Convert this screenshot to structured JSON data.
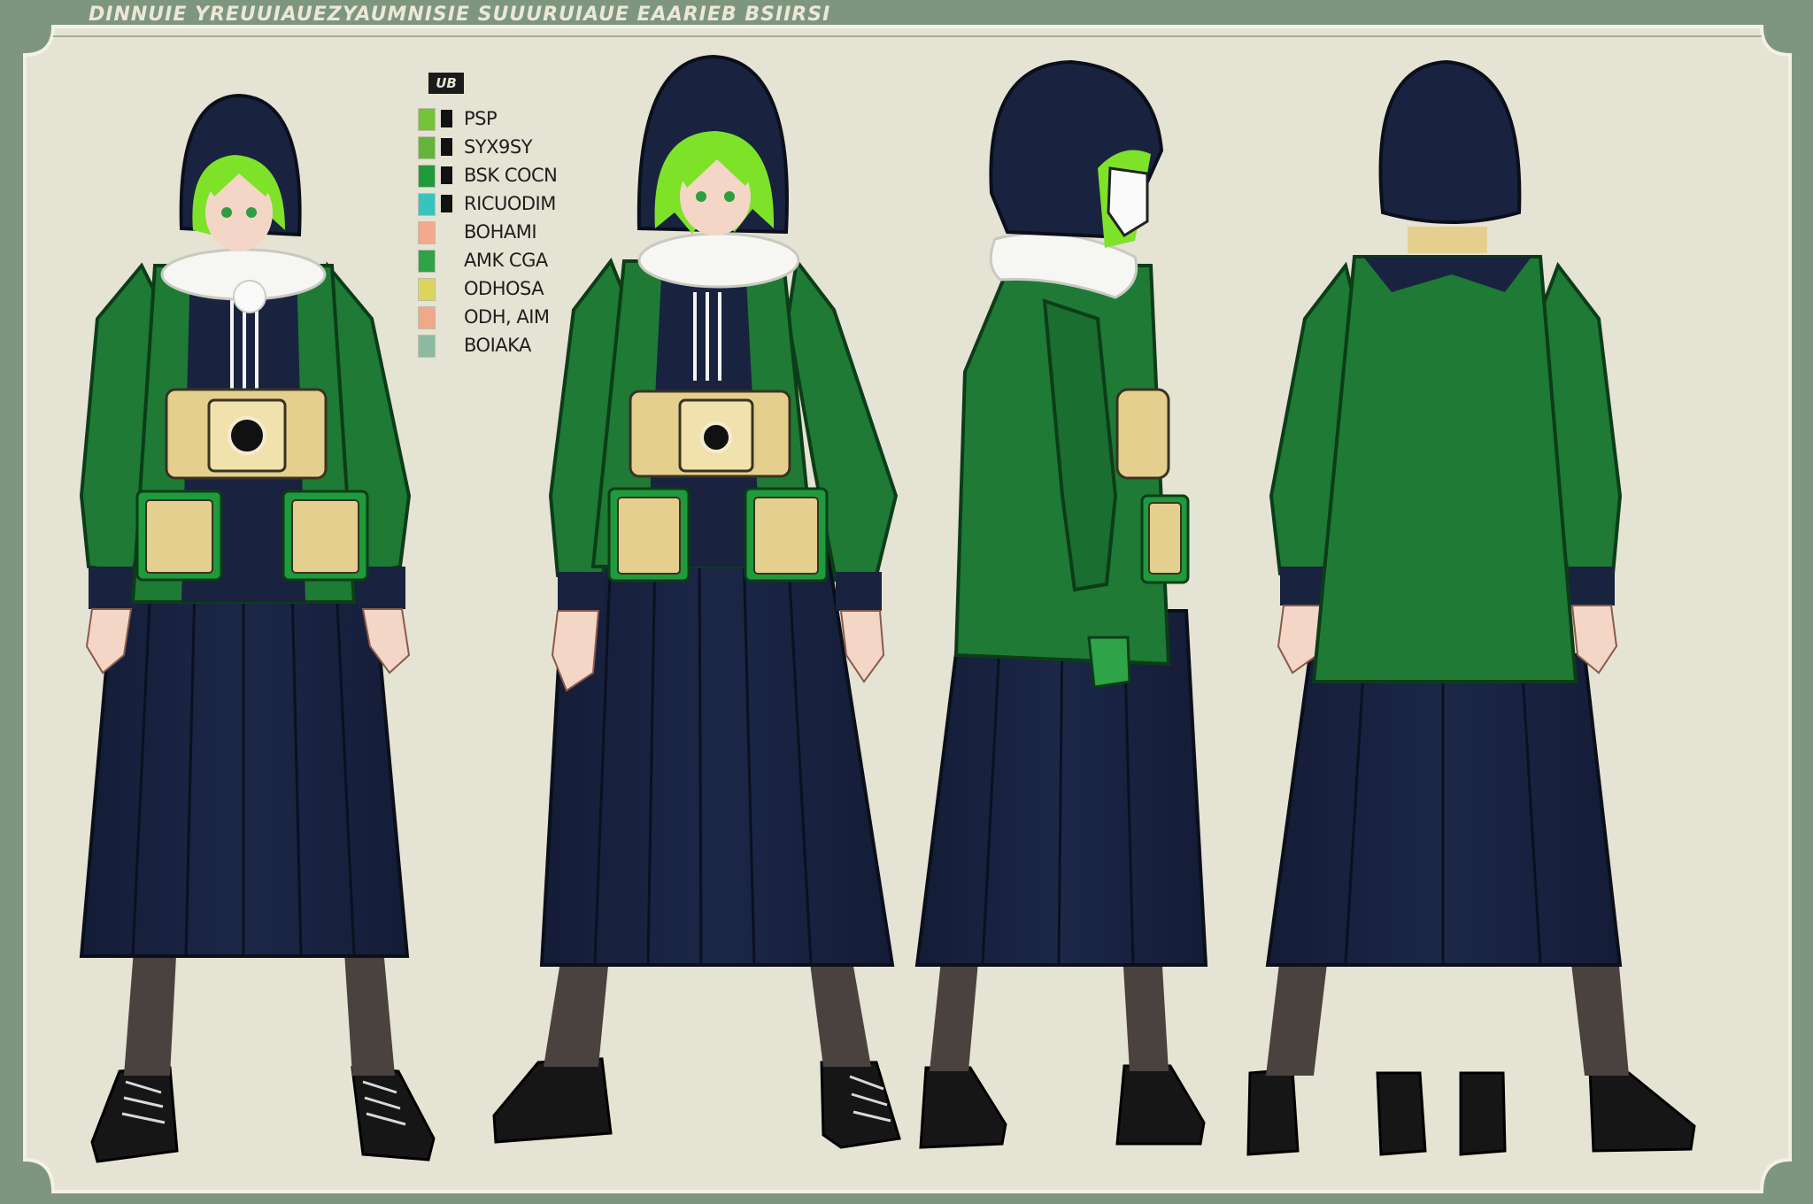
{
  "header": {
    "title": "DINNUIE YREUUIAUEZYAUMNISIE SUUURUIAUE EAARIEB BSIIRSI"
  },
  "palette": {
    "heading": "UB",
    "swatches": [
      {
        "label": "PSP",
        "color": "#74c33a",
        "dark": "#111111"
      },
      {
        "label": "SYX9SY",
        "color": "#63b53a",
        "dark": "#111111"
      },
      {
        "label": "BSK COCN",
        "color": "#1f9a3c",
        "dark": "#111111"
      },
      {
        "label": "RICUODIM",
        "color": "#37c4be",
        "dark": "#111111"
      },
      {
        "label": "BOHAMI",
        "color": "#f2a98e",
        "dark": null
      },
      {
        "label": "AMK CGA",
        "color": "#2ea348",
        "dark": null
      },
      {
        "label": "ODHOSA",
        "color": "#dcd45c",
        "dark": null
      },
      {
        "label": "ODH, AIM",
        "color": "#f0a888",
        "dark": null
      },
      {
        "label": "BOIAKA",
        "color": "#8cbaa0",
        "dark": null
      }
    ]
  },
  "colors": {
    "background": "#e5e3d3",
    "frame": "#7e9680",
    "coat_green": "#1e7a34",
    "navy": "#192340",
    "hair": "#7ee229",
    "khaki": "#e4cf8e",
    "fur": "#f6f6f2",
    "skin": "#f3d6c6",
    "tights": "#4a423f",
    "boot": "#141414"
  },
  "views": [
    "front-three-quarter",
    "front",
    "side",
    "back"
  ]
}
